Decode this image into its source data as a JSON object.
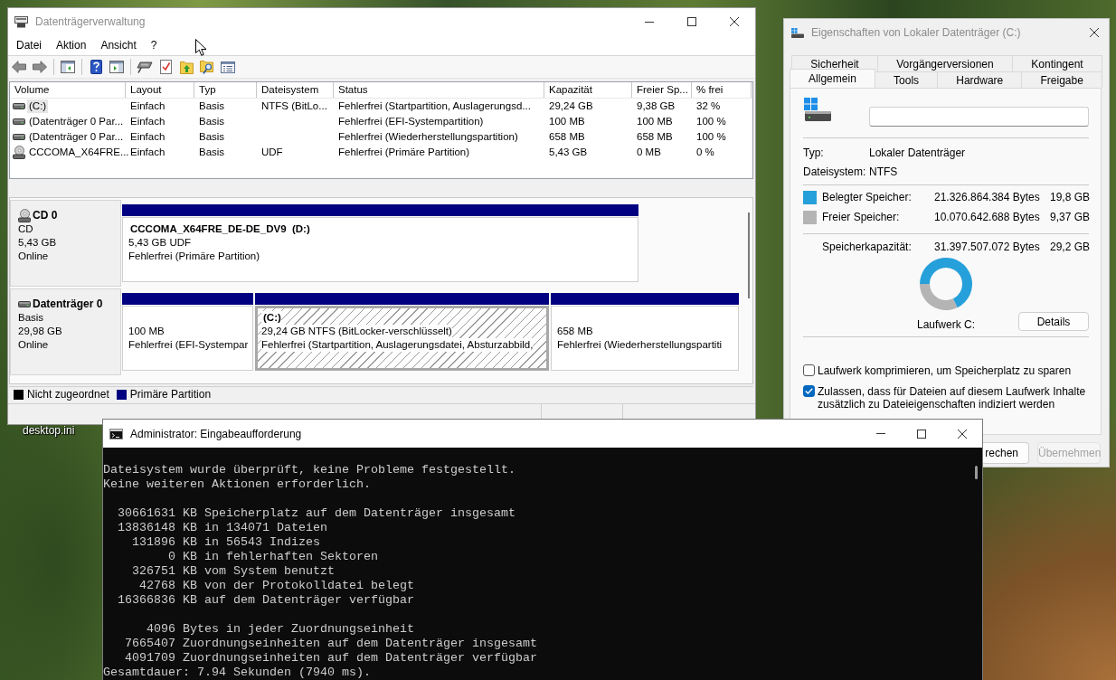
{
  "desktop": {
    "icon_labels": [
      "desktop.ini"
    ]
  },
  "disk_management": {
    "title": "Datenträgerverwaltung",
    "menu": [
      "Datei",
      "Aktion",
      "Ansicht",
      "?"
    ],
    "volume_table": {
      "columns": [
        "Volume",
        "Layout",
        "Typ",
        "Dateisystem",
        "Status",
        "Kapazität",
        "Freier Sp...",
        "% frei"
      ],
      "rows": [
        {
          "kind": "disk",
          "selected": true,
          "cells": {
            "volume": "(C:)",
            "layout": "Einfach",
            "type": "Basis",
            "file_system": "NTFS (BitLo...",
            "status": "Fehlerfrei (Startpartition, Auslagerungsd...",
            "capacity": "29,24 GB",
            "free_space": "9,38 GB",
            "percent_free": "32 %"
          }
        },
        {
          "kind": "disk",
          "selected": false,
          "cells": {
            "volume": "(Datenträger 0 Par...",
            "layout": "Einfach",
            "type": "Basis",
            "status": "Fehlerfrei (EFI-Systempartition)",
            "capacity": "100 MB",
            "free_space": "100 MB",
            "percent_free": "100 %"
          }
        },
        {
          "kind": "disk",
          "selected": false,
          "cells": {
            "volume": "(Datenträger 0 Par...",
            "layout": "Einfach",
            "type": "Basis",
            "status": "Fehlerfrei (Wiederherstellungspartition)",
            "capacity": "658 MB",
            "free_space": "658 MB",
            "percent_free": "100 %"
          }
        },
        {
          "kind": "cd",
          "selected": false,
          "cells": {
            "volume": "CCCOMA_X64FRE...",
            "layout": "Einfach",
            "type": "Basis",
            "file_system": "UDF",
            "status": "Fehlerfrei (Primäre Partition)",
            "capacity": "5,43 GB",
            "free_space": "0 MB",
            "percent_free": "0 %"
          }
        }
      ]
    },
    "disks": [
      {
        "kind": "cd",
        "name": "CD 0",
        "details": [
          "CD",
          "5,43 GB",
          "Online"
        ],
        "partitions": [
          {
            "selected": false,
            "label": "CCCOMA_X64FRE_DE-DE_DV9  (D:)",
            "lines": [
              "5,43 GB UDF",
              "Fehlerfrei (Primäre Partition)"
            ]
          }
        ]
      },
      {
        "kind": "disk",
        "name": "Datenträger 0",
        "details": [
          "Basis",
          "29,98 GB",
          "Online"
        ],
        "partitions": [
          {
            "selected": false,
            "lines": [
              "100 MB",
              "Fehlerfrei (EFI-Systempar"
            ]
          },
          {
            "selected": true,
            "label": "(C:)",
            "lines": [
              "29,24 GB NTFS (BitLocker-verschlüsselt)",
              "Fehlerfrei (Startpartition, Auslagerungsdatei, Absturzabbild,"
            ]
          },
          {
            "selected": false,
            "lines": [
              "658 MB",
              "Fehlerfrei (Wiederherstellungspartiti"
            ]
          }
        ]
      }
    ],
    "legend": [
      {
        "label": "Nicht zugeordnet",
        "color": "#000000"
      },
      {
        "label": "Primäre Partition",
        "color": "#000080"
      }
    ]
  },
  "properties": {
    "title": "Eigenschaften von Lokaler Datenträger (C:)",
    "tab_rows": [
      [
        {
          "label": "Sicherheit",
          "selected": false
        },
        {
          "label": "Vorgängerversionen",
          "selected": false
        },
        {
          "label": "Kontingent",
          "selected": false
        }
      ],
      [
        {
          "label": "Allgemein",
          "selected": true
        },
        {
          "label": "Tools",
          "selected": false
        },
        {
          "label": "Hardware",
          "selected": false
        },
        {
          "label": "Freigabe",
          "selected": false
        }
      ]
    ],
    "info": [
      {
        "label": "Typ:",
        "value": "Lokaler Datenträger"
      },
      {
        "label": "Dateisystem:",
        "value": "NTFS"
      }
    ],
    "usage": [
      {
        "label": "Belegter Speicher:",
        "bytes": "21.326.864.384 Bytes",
        "size": "19,8 GB",
        "color": "#26a0da"
      },
      {
        "label": "Freier Speicher:",
        "bytes": "10.070.642.688 Bytes",
        "size": "9,37 GB",
        "color": "#b4b4b4"
      }
    ],
    "capacity": {
      "label": "Speicherkapazität:",
      "bytes": "31.397.507.072 Bytes",
      "size": "29,2 GB"
    },
    "chart_data": {
      "type": "donut",
      "values": [
        67.9,
        32.1
      ]
    },
    "drive_label": "Laufwerk C:",
    "details_button": "Details",
    "options": [
      {
        "label": "Laufwerk komprimieren, um Speicherplatz zu sparen",
        "checked": false
      },
      {
        "label": "Zulassen, dass für Dateien auf diesem Laufwerk Inhalte zusätzlich zu Dateieigenschaften indiziert werden",
        "checked": true
      }
    ],
    "buttons": [
      {
        "label": "rechen",
        "disabled": false
      },
      {
        "label": "Übernehmen",
        "disabled": true
      }
    ]
  },
  "console": {
    "title": "Administrator: Eingabeaufforderung",
    "output": [
      [
        "Dateisystem wurde überprüft, keine Probleme festgestellt.",
        "Keine weiteren Aktionen erforderlich."
      ],
      [
        "  30661631 KB Speicherplatz auf dem Datenträger insgesamt",
        "  13836148 KB in 134071 Dateien",
        "    131896 KB in 56543 Indizes",
        "         0 KB in fehlerhaften Sektoren",
        "    326751 KB vom System benutzt",
        "     42768 KB von der Protokolldatei belegt",
        "  16366836 KB auf dem Datenträger verfügbar"
      ],
      [
        "      4096 Bytes in jeder Zuordnungseinheit",
        "   7665407 Zuordnungseinheiten auf dem Datenträger insgesamt",
        "   4091709 Zuordnungseinheiten auf dem Datenträger verfügbar",
        "Gesamtdauer: 7.94 Sekunden (7940 ms)."
      ]
    ]
  }
}
